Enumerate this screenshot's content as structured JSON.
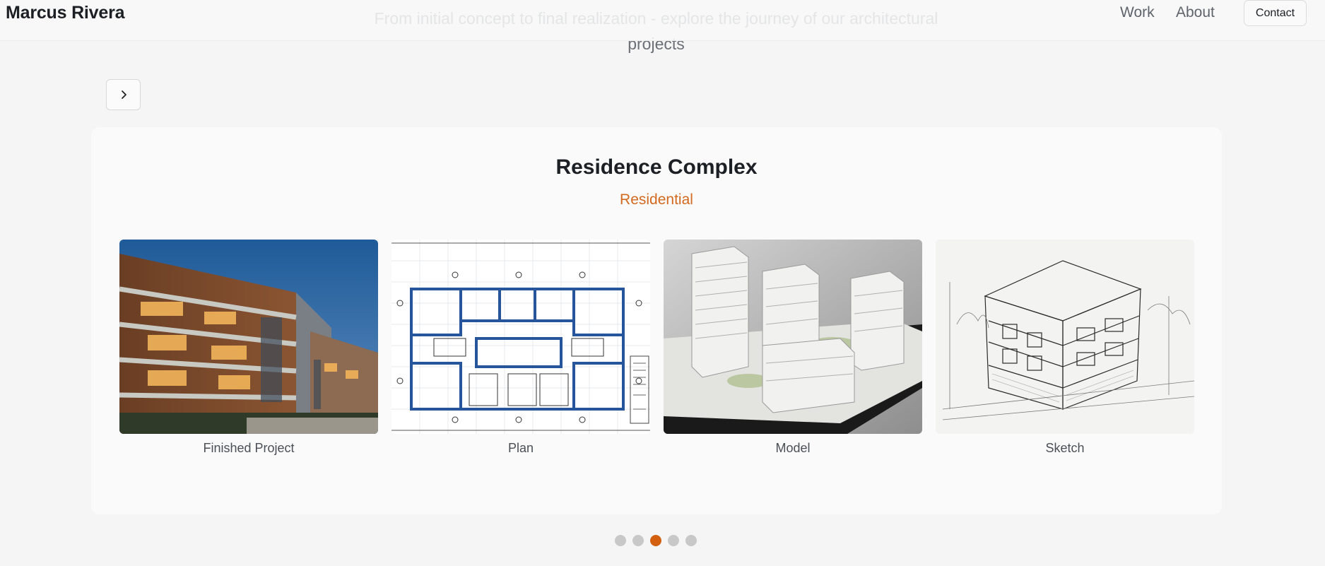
{
  "header": {
    "brand": "Marcus Rivera",
    "nav": [
      {
        "label": "Work"
      },
      {
        "label": "About"
      }
    ],
    "contact_label": "Contact"
  },
  "hero": {
    "subtitle": "From initial concept to final realization - explore the journey of our architectural projects"
  },
  "carousel": {
    "next_icon": "chevron-right-icon",
    "current_slide": 3,
    "slide_count": 5
  },
  "project": {
    "title": "Residence Complex",
    "category": "Residential",
    "stages": [
      {
        "label": "Finished Project",
        "image": "finished-building-photo"
      },
      {
        "label": "Plan",
        "image": "floor-plan-drawing"
      },
      {
        "label": "Model",
        "image": "architectural-model-photo"
      },
      {
        "label": "Sketch",
        "image": "pencil-sketch"
      }
    ]
  },
  "colors": {
    "accent": "#d2600f",
    "category": "#d2691e",
    "background": "#f5f5f5",
    "card": "#fafafa"
  }
}
